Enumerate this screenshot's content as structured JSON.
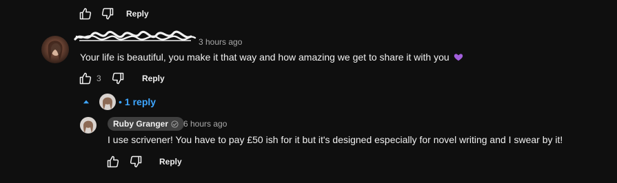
{
  "top_actions": {
    "reply_label": "Reply"
  },
  "comment": {
    "timestamp": "3 hours ago",
    "text": "Your life is beautiful, you make it that way and how amazing we get to share it with you",
    "emoji": "purple-heart",
    "like_count": "3",
    "reply_label": "Reply",
    "replies_toggle": {
      "dot": "•",
      "label": "1 reply"
    }
  },
  "reply": {
    "author": "Ruby Granger",
    "timestamp": "6 hours ago",
    "text": "I use scrivener! You have to pay £50 ish for it but it's designed especially for novel writing and I swear by it!",
    "reply_label": "Reply"
  },
  "colors": {
    "background": "#0f0f0f",
    "text_primary": "#f1f1f1",
    "text_secondary": "#aaaaaa",
    "link_blue": "#3ea6ff",
    "chip_bg": "#3f3f3f",
    "emoji_purple": "#a25fdb"
  }
}
